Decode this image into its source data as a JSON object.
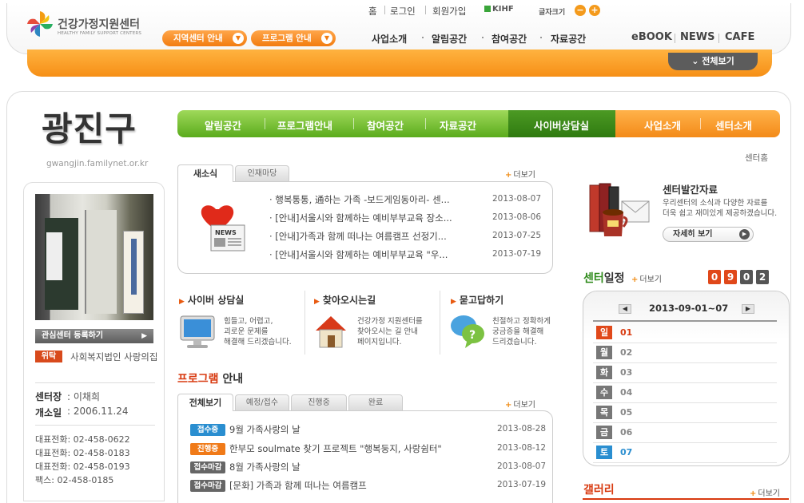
{
  "header": {
    "logo_title": "건강가정지원센터",
    "logo_subtitle": "HEALTHY FAMILY SUPPORT CENTERS",
    "util_links": [
      "홈",
      "로그인",
      "회원가입"
    ],
    "kihf": "KIHF",
    "font_size_label": "글자크기",
    "font_minus": "−",
    "font_plus": "+",
    "pill_region": "지역센터 안내",
    "pill_program": "프로그램 안내",
    "nav": [
      "사업소개",
      "알림공간",
      "참여공간",
      "자료공간"
    ],
    "right_nav": [
      "eBOOK",
      "NEWS",
      "CAFE"
    ],
    "all_view": "전체보기",
    "colors": {
      "orange": "#f68f16",
      "green": "#5aab1c",
      "dark_green": "#2f7a10"
    }
  },
  "region": {
    "name": "광진구",
    "url": "gwangjin.familynet.or.kr"
  },
  "main_nav": {
    "green": [
      "알림공간",
      "프로그램안내",
      "참여공간",
      "자료공간"
    ],
    "dark": "사이버상담실",
    "orange": [
      "사업소개",
      "센터소개"
    ]
  },
  "center_home": "센터홈",
  "left": {
    "register_btn": "관심센터 등록하기",
    "wit_badge": "위탁",
    "wit_text": "사회복지법인 사랑의집",
    "director_label": "센터장",
    "director": ": 이채희",
    "opened_label": "개소일",
    "opened": ": 2006.11.24",
    "phones": [
      "대표전화: 02-458-0622",
      "대표전화: 02-458-0183",
      "대표전화: 02-458-0193",
      "팩스: 02-458-0185"
    ]
  },
  "news": {
    "tabs": [
      "새소식",
      "인재마당"
    ],
    "more": "더보기",
    "items": [
      {
        "title": "· 행복통통, 通하는 가족 -보드게임동아리- 센...",
        "date": "2013-08-07"
      },
      {
        "title": "· [안내]서울시와 함께하는 예비부부교육 장소...",
        "date": "2013-08-06"
      },
      {
        "title": "· [안내]가족과 함께 떠나는 여름캠프 선정기...",
        "date": "2013-07-25"
      },
      {
        "title": "· [안내]서울시와 함께하는 예비부부교육 \"우...",
        "date": "2013-07-19"
      }
    ]
  },
  "quick": [
    {
      "title": "사이버 상담실",
      "desc": [
        "힘들고, 어렵고,",
        "괴로운 문제를",
        "해결해 드리겠습니다."
      ]
    },
    {
      "title": "찾아오시는길",
      "desc": [
        "건강가정 지원센터를",
        "찾아오시는 길 안내",
        "페이지입니다."
      ]
    },
    {
      "title": "묻고답하기",
      "desc": [
        "친절하고 정확하게",
        "궁금증을 해결해",
        "드리겠습니다."
      ]
    }
  ],
  "program": {
    "title_red": "프로그램",
    "title_rest": " 안내",
    "tabs": [
      "전체보기",
      "예정/접수",
      "진행중",
      "완료"
    ],
    "more": "더보기",
    "items": [
      {
        "badge": "접수중",
        "badge_color": "#2a8ed0",
        "title": "9월 가족사랑의 날",
        "date": "2013-08-28"
      },
      {
        "badge": "진행중",
        "badge_color": "#f07a18",
        "title": "한부모 soulmate 찾기 프로젝트 \"행복둥지, 사랑쉼터\"",
        "date": "2013-08-12"
      },
      {
        "badge": "접수마감",
        "badge_color": "#666666",
        "title": "8월 가족사랑의 날",
        "date": "2013-08-07"
      },
      {
        "badge": "접수마감",
        "badge_color": "#666666",
        "title": "[문화] 가족과 함께 떠나는 여름캠프",
        "date": "2013-07-19"
      }
    ]
  },
  "publication": {
    "title": "센터발간자료",
    "desc": [
      "우리센터의 소식과 다양한 자료를",
      "더욱 쉽고 재미있게 제공하겠습니다."
    ],
    "btn": "자세히 보기"
  },
  "schedule": {
    "title_green": "센터",
    "title_rest": "일정",
    "more": "더보기",
    "counter": [
      "0",
      "9",
      "0",
      "2"
    ],
    "week": "2013-09-01~07",
    "prev": "◀",
    "next": "▶",
    "days": [
      {
        "day": "일",
        "num": "01",
        "badge_color": "#e0481a",
        "num_color": "#d83a10"
      },
      {
        "day": "월",
        "num": "02",
        "badge_color": "#777777",
        "num_color": "#888888"
      },
      {
        "day": "화",
        "num": "03",
        "badge_color": "#777777",
        "num_color": "#888888"
      },
      {
        "day": "수",
        "num": "04",
        "badge_color": "#777777",
        "num_color": "#888888"
      },
      {
        "day": "목",
        "num": "05",
        "badge_color": "#777777",
        "num_color": "#888888"
      },
      {
        "day": "금",
        "num": "06",
        "badge_color": "#777777",
        "num_color": "#888888"
      },
      {
        "day": "토",
        "num": "07",
        "badge_color": "#2a8ed0",
        "num_color": "#2a8ed0"
      }
    ]
  },
  "gallery": {
    "title": "갤러리",
    "more": "더보기"
  }
}
